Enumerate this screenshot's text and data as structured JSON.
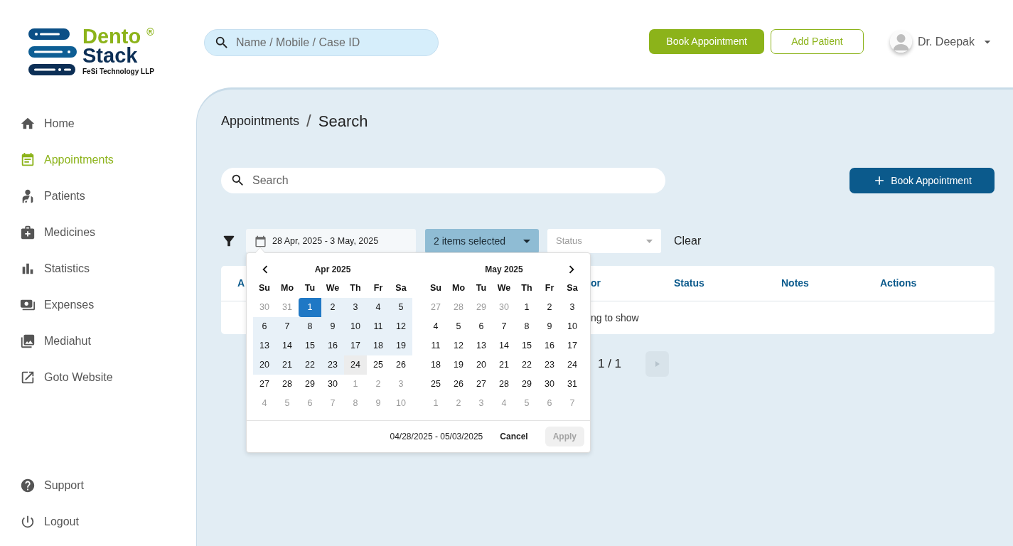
{
  "logo": {
    "top": "Dento",
    "bottom": "Stack",
    "mark": "®",
    "company": "FeSi Technology LLP"
  },
  "top_search": {
    "placeholder": "Name / Mobile / Case ID"
  },
  "header_buttons": [
    {
      "label": "Book Appointment",
      "kind": "primary"
    },
    {
      "label": "Add Patient",
      "kind": "outline"
    }
  ],
  "user": {
    "name": "Dr. Deepak"
  },
  "sidebar": {
    "items": [
      {
        "label": "Home",
        "selected": false
      },
      {
        "label": "Appointments",
        "selected": true
      },
      {
        "label": "Patients",
        "selected": false
      },
      {
        "label": "Medicines",
        "selected": false
      },
      {
        "label": "Statistics",
        "selected": false
      },
      {
        "label": "Expenses",
        "selected": false
      },
      {
        "label": "Mediahut",
        "selected": false
      },
      {
        "label": "Goto Website",
        "selected": false
      }
    ],
    "bottom_items": [
      {
        "label": "Support"
      },
      {
        "label": "Logout"
      }
    ]
  },
  "breadcrumb": {
    "parent": "Appointments",
    "separator": "/",
    "current": "Search"
  },
  "search": {
    "placeholder": "Search"
  },
  "book_button": {
    "label": "Book Appointment"
  },
  "filters": {
    "date_range": "28 Apr, 2025 - 3 May, 2025",
    "type_select": "2 items selected",
    "status_select": {
      "placeholder": "Status"
    },
    "clear": "Clear"
  },
  "table": {
    "columns": [
      "A",
      "or",
      "Status",
      "Notes",
      "Actions"
    ],
    "empty_message": "ng to show"
  },
  "pagination": {
    "page": "1 / 1"
  },
  "date_picker": {
    "months": [
      {
        "title": "Apr 2025",
        "weekdays": [
          "Su",
          "Mo",
          "Tu",
          "We",
          "Th",
          "Fr",
          "Sa"
        ],
        "weeks": [
          [
            {
              "d": "30",
              "kind": "outside"
            },
            {
              "d": "31",
              "kind": "outside"
            },
            {
              "d": "1",
              "kind": "start"
            },
            {
              "d": "2",
              "kind": "range"
            },
            {
              "d": "3",
              "kind": "range"
            },
            {
              "d": "4",
              "kind": "range"
            },
            {
              "d": "5",
              "kind": "range"
            }
          ],
          [
            {
              "d": "6",
              "kind": "range"
            },
            {
              "d": "7",
              "kind": "range"
            },
            {
              "d": "8",
              "kind": "range"
            },
            {
              "d": "9",
              "kind": "range"
            },
            {
              "d": "10",
              "kind": "range"
            },
            {
              "d": "11",
              "kind": "range"
            },
            {
              "d": "12",
              "kind": "range"
            }
          ],
          [
            {
              "d": "13",
              "kind": "range"
            },
            {
              "d": "14",
              "kind": "range"
            },
            {
              "d": "15",
              "kind": "range"
            },
            {
              "d": "16",
              "kind": "range"
            },
            {
              "d": "17",
              "kind": "range"
            },
            {
              "d": "18",
              "kind": "range"
            },
            {
              "d": "19",
              "kind": "range"
            }
          ],
          [
            {
              "d": "20",
              "kind": "range"
            },
            {
              "d": "21",
              "kind": "range"
            },
            {
              "d": "22",
              "kind": "range"
            },
            {
              "d": "23",
              "kind": "range"
            },
            {
              "d": "24",
              "kind": "today"
            },
            {
              "d": "25",
              "kind": "normal"
            },
            {
              "d": "26",
              "kind": "normal"
            }
          ],
          [
            {
              "d": "27",
              "kind": "normal"
            },
            {
              "d": "28",
              "kind": "normal"
            },
            {
              "d": "29",
              "kind": "normal"
            },
            {
              "d": "30",
              "kind": "normal"
            },
            {
              "d": "1",
              "kind": "outside"
            },
            {
              "d": "2",
              "kind": "outside"
            },
            {
              "d": "3",
              "kind": "outside"
            }
          ],
          [
            {
              "d": "4",
              "kind": "outside"
            },
            {
              "d": "5",
              "kind": "outside"
            },
            {
              "d": "6",
              "kind": "outside"
            },
            {
              "d": "7",
              "kind": "outside"
            },
            {
              "d": "8",
              "kind": "outside"
            },
            {
              "d": "9",
              "kind": "outside"
            },
            {
              "d": "10",
              "kind": "outside"
            }
          ]
        ]
      },
      {
        "title": "May 2025",
        "weekdays": [
          "Su",
          "Mo",
          "Tu",
          "We",
          "Th",
          "Fr",
          "Sa"
        ],
        "weeks": [
          [
            {
              "d": "27",
              "kind": "outside"
            },
            {
              "d": "28",
              "kind": "outside"
            },
            {
              "d": "29",
              "kind": "outside"
            },
            {
              "d": "30",
              "kind": "outside"
            },
            {
              "d": "1",
              "kind": "normal"
            },
            {
              "d": "2",
              "kind": "normal"
            },
            {
              "d": "3",
              "kind": "normal"
            }
          ],
          [
            {
              "d": "4",
              "kind": "normal"
            },
            {
              "d": "5",
              "kind": "normal"
            },
            {
              "d": "6",
              "kind": "normal"
            },
            {
              "d": "7",
              "kind": "normal"
            },
            {
              "d": "8",
              "kind": "normal"
            },
            {
              "d": "9",
              "kind": "normal"
            },
            {
              "d": "10",
              "kind": "normal"
            }
          ],
          [
            {
              "d": "11",
              "kind": "normal"
            },
            {
              "d": "12",
              "kind": "normal"
            },
            {
              "d": "13",
              "kind": "normal"
            },
            {
              "d": "14",
              "kind": "normal"
            },
            {
              "d": "15",
              "kind": "normal"
            },
            {
              "d": "16",
              "kind": "normal"
            },
            {
              "d": "17",
              "kind": "normal"
            }
          ],
          [
            {
              "d": "18",
              "kind": "normal"
            },
            {
              "d": "19",
              "kind": "normal"
            },
            {
              "d": "20",
              "kind": "normal"
            },
            {
              "d": "21",
              "kind": "normal"
            },
            {
              "d": "22",
              "kind": "normal"
            },
            {
              "d": "23",
              "kind": "normal"
            },
            {
              "d": "24",
              "kind": "normal"
            }
          ],
          [
            {
              "d": "25",
              "kind": "normal"
            },
            {
              "d": "26",
              "kind": "normal"
            },
            {
              "d": "27",
              "kind": "normal"
            },
            {
              "d": "28",
              "kind": "normal"
            },
            {
              "d": "29",
              "kind": "normal"
            },
            {
              "d": "30",
              "kind": "normal"
            },
            {
              "d": "31",
              "kind": "normal"
            }
          ],
          [
            {
              "d": "1",
              "kind": "outside"
            },
            {
              "d": "2",
              "kind": "outside"
            },
            {
              "d": "3",
              "kind": "outside"
            },
            {
              "d": "4",
              "kind": "outside"
            },
            {
              "d": "5",
              "kind": "outside"
            },
            {
              "d": "6",
              "kind": "outside"
            },
            {
              "d": "7",
              "kind": "outside"
            }
          ]
        ]
      }
    ],
    "range_text": "04/28/2025 - 05/03/2025",
    "cancel": "Cancel",
    "apply": {
      "label": "Apply",
      "disabled": true
    }
  }
}
